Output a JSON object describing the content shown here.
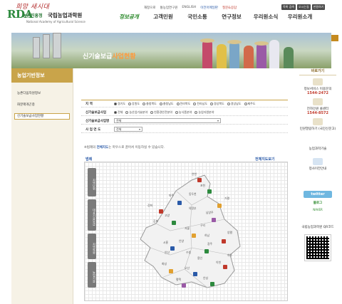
{
  "header": {
    "slogan": "희망 새시대",
    "rda": "RDA",
    "rda_sub": "농촌진흥청",
    "institute": "국립농업과학원",
    "institute_en": "National Academy of Agricultural Science",
    "toplinks": [
      "재창으로",
      "통농업연구원",
      "ENGLISH",
      "이전어메일판",
      "질문&응답"
    ],
    "topbtns": [
      "목록 검색",
      "오시는길",
      "만원하기"
    ]
  },
  "gnb": [
    "정보공개",
    "고객민원",
    "국민소통",
    "연구정보",
    "우리원소식",
    "우리원소개"
  ],
  "subnav_tab": "농업과학기술 ▸",
  "hero": {
    "title_part1": "신기술보급",
    "title_part2": "사업현황"
  },
  "lnb": {
    "title": "농업기반정보",
    "items": [
      "농촌다움자원정보",
      "화분매개곤충",
      "신기술보급사업현황"
    ]
  },
  "filter": {
    "region_label": "지 역",
    "regions": [
      "경기도",
      "강원도",
      "충청북도",
      "충청남도",
      "전라북도",
      "전라남도",
      "경상북도",
      "경상남도",
      "제주도"
    ],
    "project_type_label": "신기술보급사업",
    "project_types": [
      "전체",
      "농산업기술분야",
      "친환경안전분야",
      "농식품분야",
      "농업자원분야"
    ],
    "project_name_label": "신기술보급사업명",
    "project_name_value": "전체",
    "year_label": "사 업 연 도",
    "year_value": "전체"
  },
  "notice": {
    "prefix": "※범례의",
    "highlight": "전체지도",
    "suffix": "는 마우스로 끌어서 이동하실 수 있습니다."
  },
  "map": {
    "legend_label": "범례",
    "fullmap_label": "전체지도보기",
    "side_legend": [
      "지역단위",
      "대표기술보급",
      "지역특화",
      "농업기술"
    ],
    "regions": [
      "연천",
      "포천",
      "가평",
      "남양주",
      "강화",
      "파주",
      "고양",
      "김포",
      "서울",
      "구리",
      "양평",
      "하남",
      "시흥",
      "광주",
      "안양",
      "여주",
      "화성",
      "용인",
      "이천",
      "평택",
      "안성",
      "오산",
      "수원",
      "안산",
      "의정부",
      "동두천"
    ]
  },
  "quick": {
    "title": "바로가기",
    "info_service": "정보서비스 이용문의",
    "info_phone": "1544-2472",
    "consult": "전자민원 콜센터",
    "consult_phone": "1544-8572",
    "civil": "민원열람하기 (국민신문고)",
    "agri_tech": "농업과학기술",
    "tech_center": "청사이전안내",
    "twitter": "twitter",
    "blog": "블로그",
    "naver": "NAVER",
    "qr_label": "국립농업과학원 QR코드"
  }
}
